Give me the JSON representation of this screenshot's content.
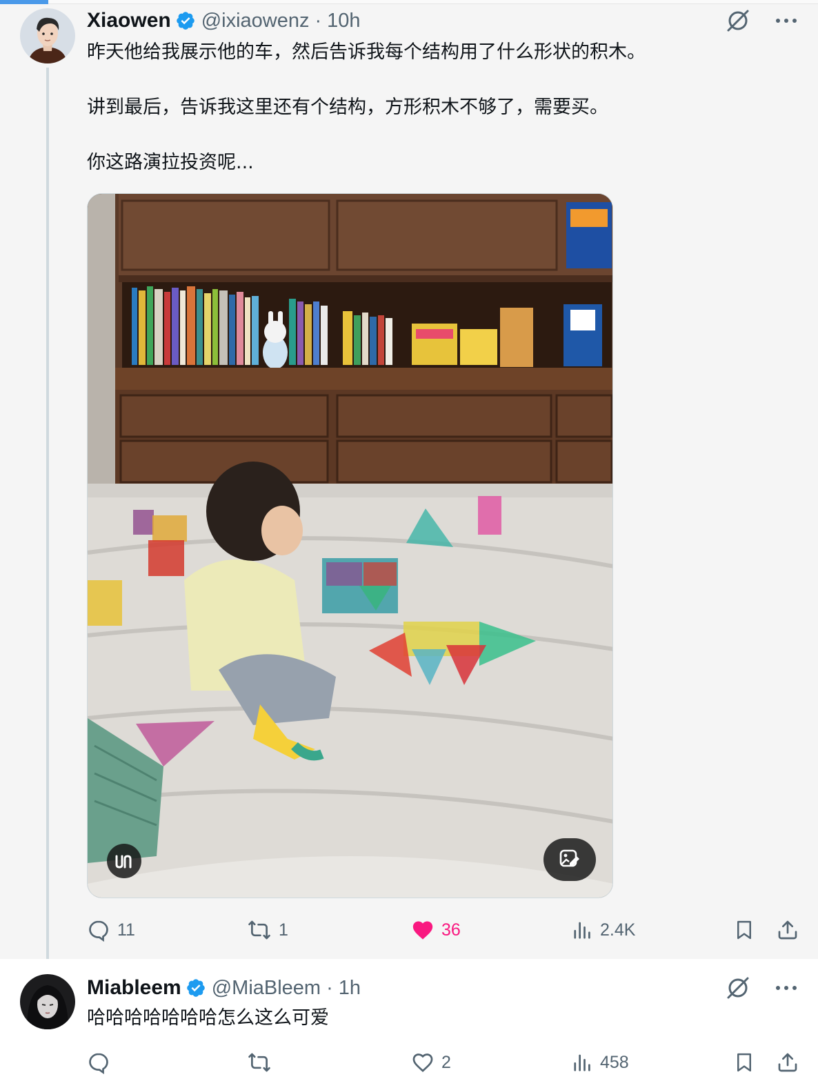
{
  "tweet": {
    "author_name": "Xiaowen",
    "handle": "@ixiaowenz",
    "separator": "·",
    "time": "10h",
    "verified": true,
    "text_lines": [
      "昨天他给我展示他的车，然后告诉我每个结构用了什么形状的积木。",
      "",
      "讲到最后，告诉我这里还有个结构，方形积木不够了，需要买。",
      "",
      "你这路演拉投资呢..."
    ],
    "media": {
      "kind": "photo",
      "description_icons": [
        "alt-text-icon",
        "edit-image-icon"
      ]
    },
    "stats": {
      "replies": "11",
      "reposts": "1",
      "likes": "36",
      "views": "2.4K",
      "liked": true
    }
  },
  "reply": {
    "author_name": "Miableem",
    "handle": "@MiaBleem",
    "separator": "·",
    "time": "1h",
    "verified": true,
    "text": "哈哈哈哈哈哈哈怎么这么可爱",
    "stats": {
      "replies": "",
      "reposts": "",
      "likes": "2",
      "views": "458",
      "liked": false
    }
  },
  "colors": {
    "verified": "#1d9bf0",
    "like": "#f91880",
    "muted": "#536471",
    "thread_line": "#cfd9de"
  }
}
